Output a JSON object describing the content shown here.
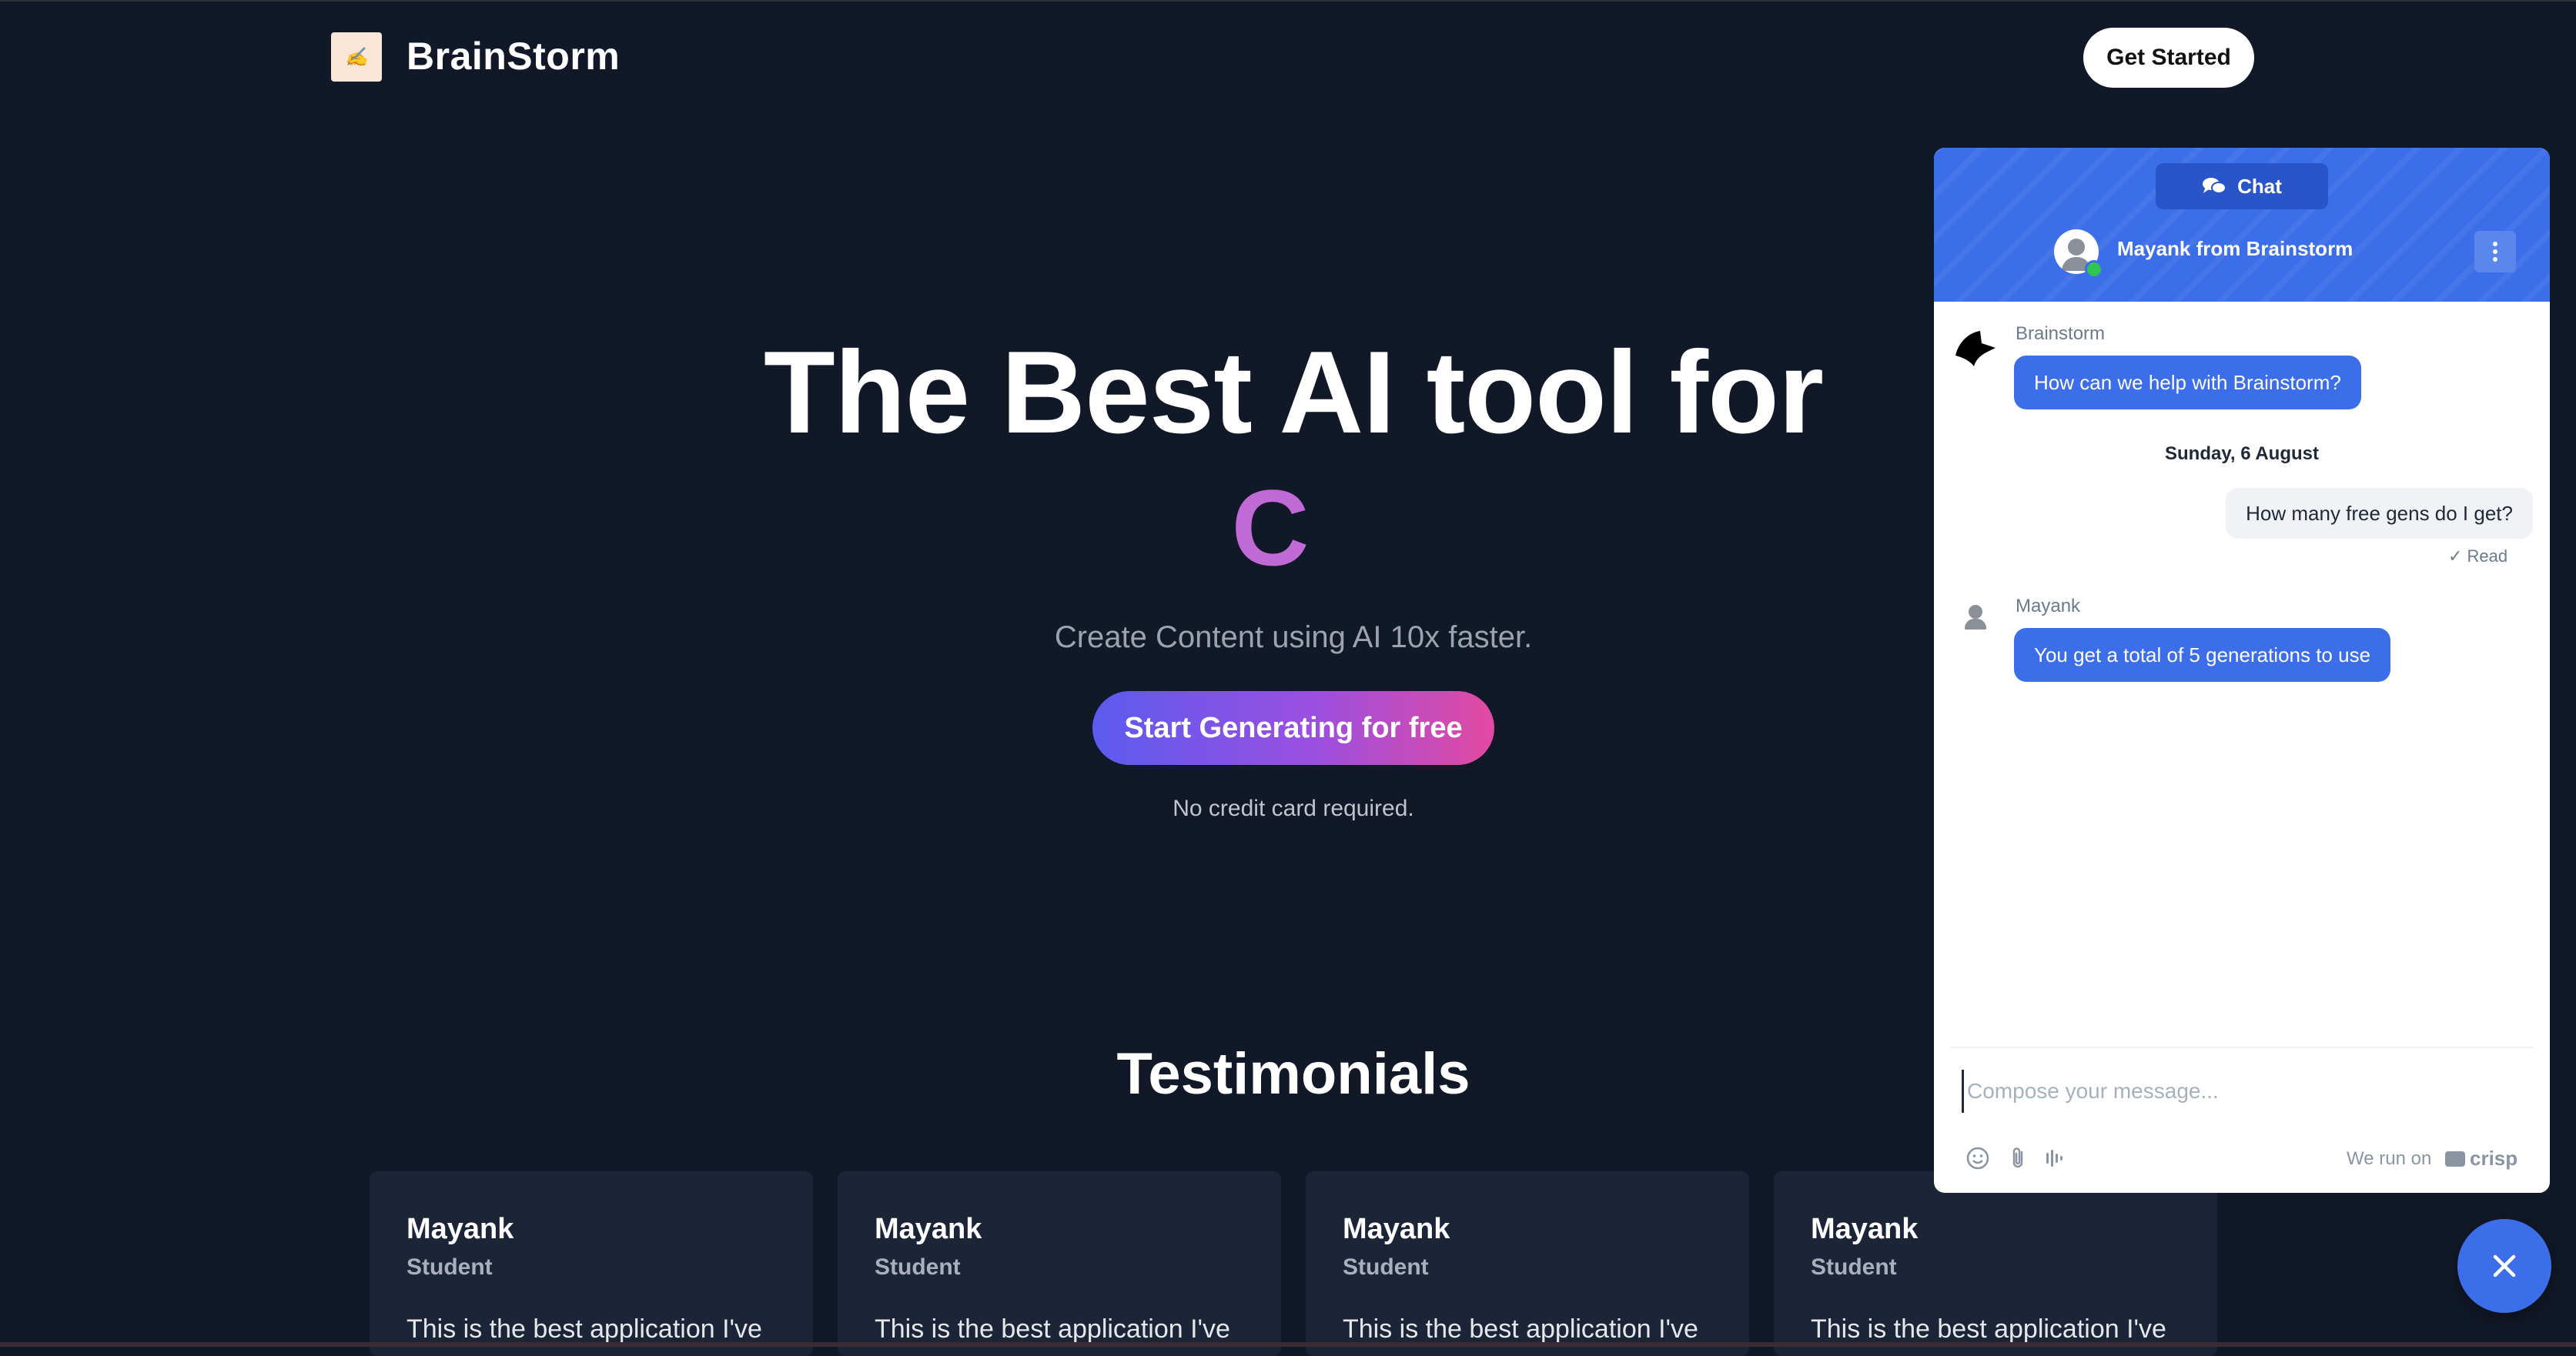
{
  "nav": {
    "brand": "BrainStorm",
    "cta_label": "Get Started"
  },
  "hero": {
    "title": "The Best AI tool for",
    "typed_letter": "C",
    "subtitle": "Create Content using AI 10x faster.",
    "cta_label": "Start Generating for free",
    "note": "No credit card required."
  },
  "testimonials": {
    "title": "Testimonials",
    "cards": [
      {
        "name": "Mayank",
        "role": "Student",
        "text": "This is the best application I've"
      },
      {
        "name": "Mayank",
        "role": "Student",
        "text": "This is the best application I've"
      },
      {
        "name": "Mayank",
        "role": "Student",
        "text": "This is the best application I've"
      },
      {
        "name": "Mayank",
        "role": "Student",
        "text": "This is the best application I've"
      }
    ]
  },
  "chat": {
    "tab_label": "Chat",
    "agent_name": "Mayank from Brainstorm",
    "messages": [
      {
        "sender": "Brainstorm",
        "text": "How can we help with Brainstorm?"
      },
      {
        "date": "Sunday, 6 August"
      },
      {
        "sender": "user",
        "text": "How many free gens do I get?",
        "status": "✓ Read"
      },
      {
        "sender": "Mayank",
        "text": "You get a total of 5 generations to use"
      }
    ],
    "compose_placeholder": "Compose your message...",
    "footer_text": "We run on",
    "footer_brand": "crisp",
    "accent_color": "#3b6ee8"
  },
  "colors": {
    "background": "#111827",
    "card": "#1c2438",
    "typed_letter": "#c06ad6"
  }
}
